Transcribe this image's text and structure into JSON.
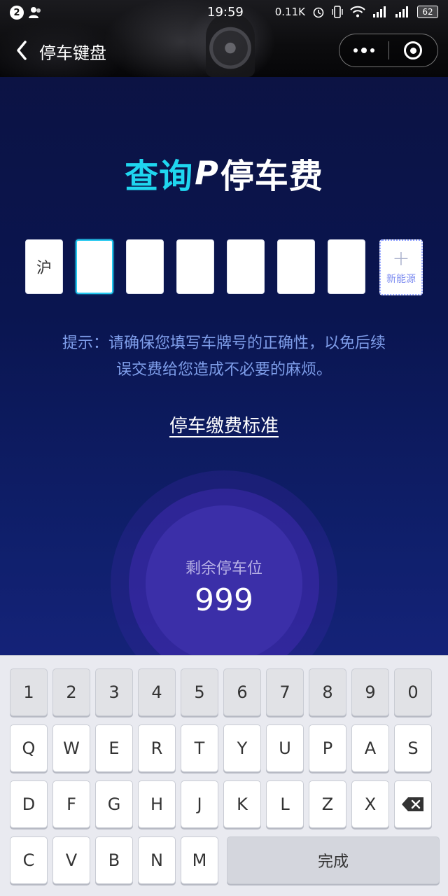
{
  "status_bar": {
    "notification_count": "2",
    "time": "19:59",
    "network_speed": "0.11K",
    "battery": "62"
  },
  "nav": {
    "title": "停车键盘",
    "back_icon": "chevron-left-icon",
    "more_icon": "more-dots-icon",
    "close_icon": "target-close-icon"
  },
  "logo": {
    "part1": "查询",
    "part2": "P",
    "part3": "停车费"
  },
  "plate": {
    "province": "沪",
    "slots": [
      "",
      "",
      "",
      "",
      "",
      ""
    ],
    "new_energy_plus": "+",
    "new_energy_label": "新能源"
  },
  "hint": {
    "line1": "提示：请确保您填写车牌号的正确性，以免后续",
    "line2": "误交费给您造成不必要的麻烦。"
  },
  "standard_link": "停车缴费标准",
  "parking": {
    "label": "剩余停车位",
    "count": "999"
  },
  "keyboard": {
    "row1": [
      "1",
      "2",
      "3",
      "4",
      "5",
      "6",
      "7",
      "8",
      "9",
      "0"
    ],
    "row2": [
      "Q",
      "W",
      "E",
      "R",
      "T",
      "Y",
      "U",
      "P",
      "A",
      "S"
    ],
    "row3": [
      "D",
      "F",
      "G",
      "H",
      "J",
      "K",
      "L",
      "Z",
      "X"
    ],
    "row4": [
      "C",
      "V",
      "B",
      "N",
      "M"
    ],
    "done": "完成",
    "delete_icon": "backspace-icon"
  },
  "colors": {
    "accent_cyan": "#1fd6ef",
    "hint_blue": "#7f9eea",
    "circle_purple": "#3b2fa8"
  }
}
